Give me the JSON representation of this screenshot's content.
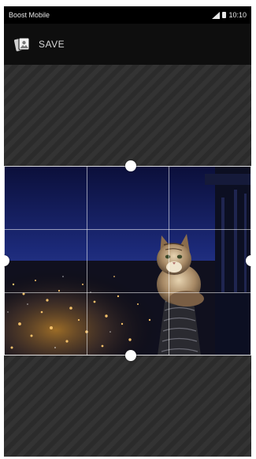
{
  "status_bar": {
    "carrier": "Boost Mobile",
    "time": "10:10",
    "signal_icon": "signal-icon",
    "battery_icon": "battery-icon"
  },
  "toolbar": {
    "save_label": "SAVE",
    "save_icon": "photos-icon"
  },
  "crop": {
    "grid": "3x3",
    "handles": [
      "top",
      "bottom",
      "left",
      "right"
    ]
  },
  "colors": {
    "background": "#2b2b2b",
    "toolbar": "#0e0e0e",
    "handle": "#ffffff"
  }
}
